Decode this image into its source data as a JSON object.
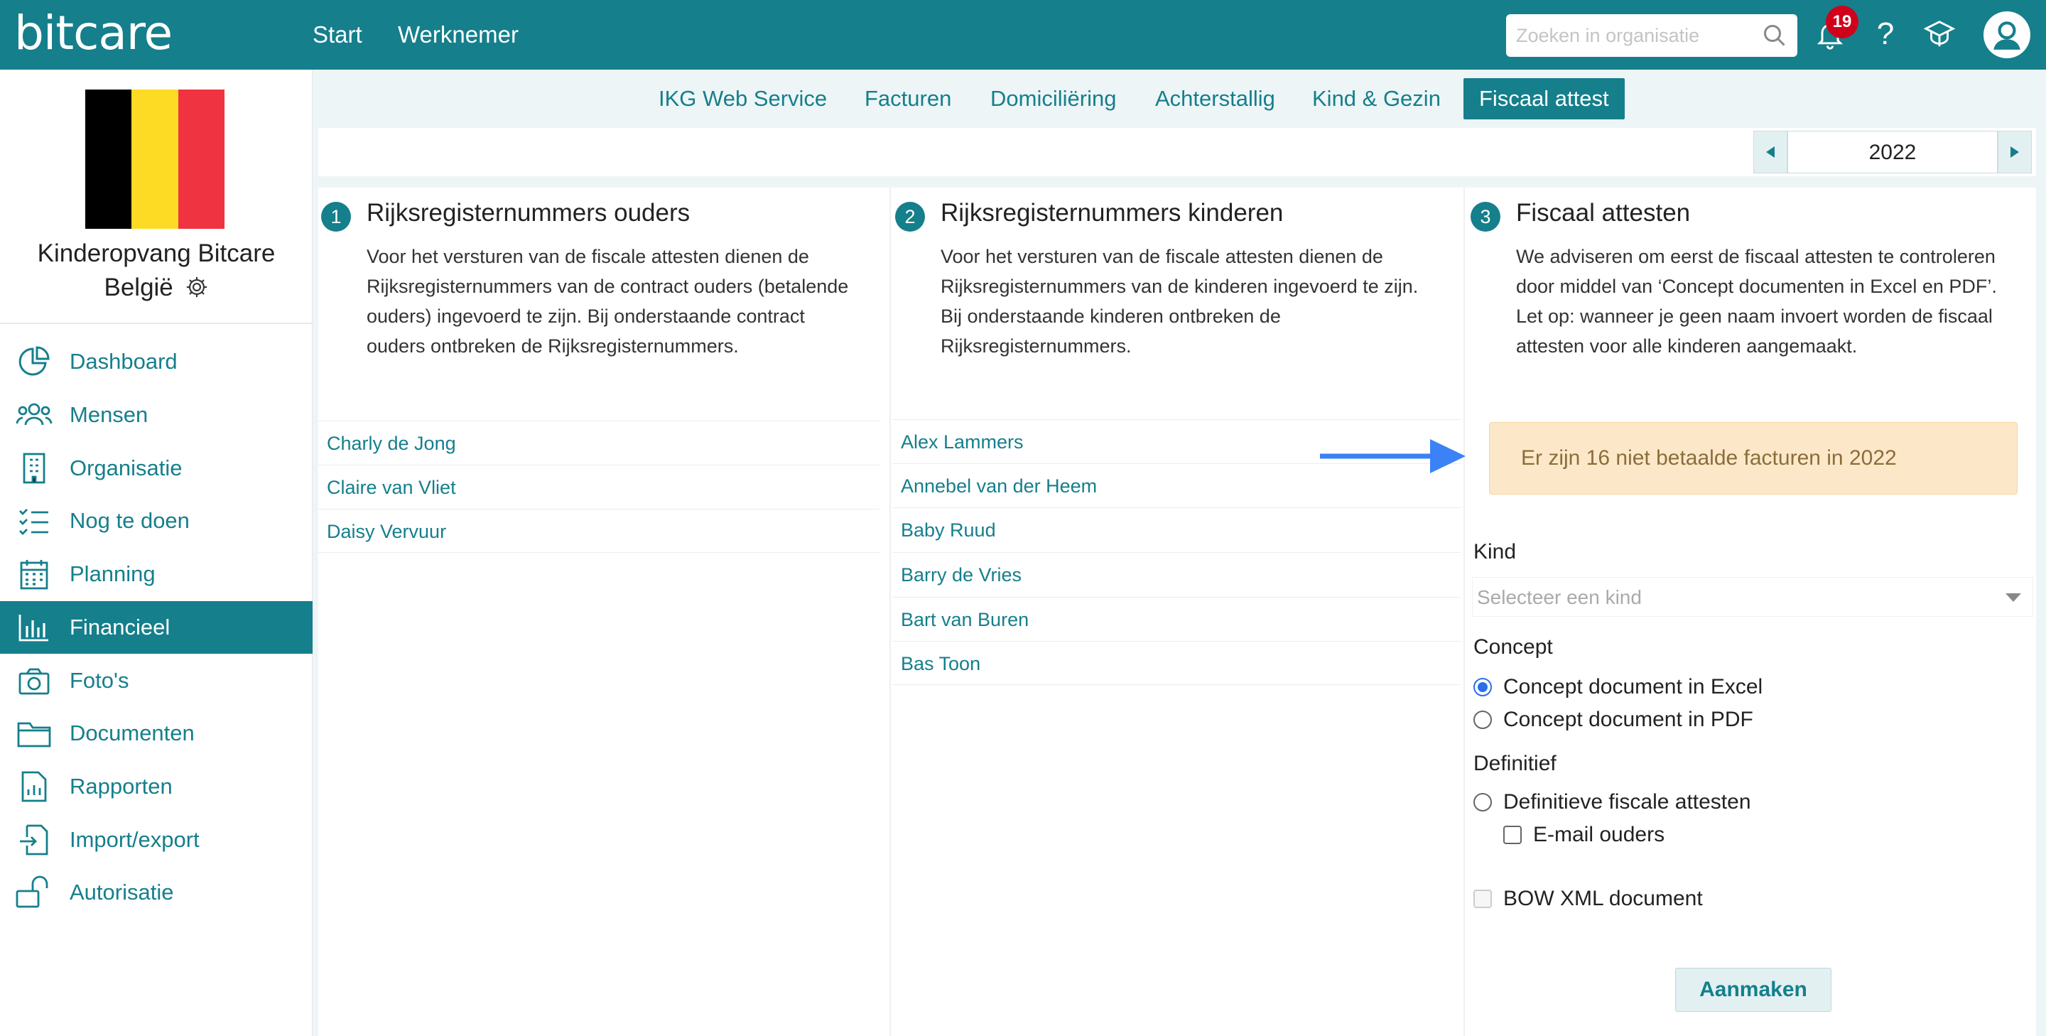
{
  "app": {
    "logo": "bitcare"
  },
  "topnav": {
    "items": [
      "Start",
      "Werknemer"
    ]
  },
  "search": {
    "placeholder": "Zoeken in organisatie"
  },
  "notifications": {
    "count": "19"
  },
  "help": {
    "label": "?"
  },
  "org": {
    "name_line1": "Kinderopvang Bitcare",
    "name_line2": "België"
  },
  "flag_colors": [
    "#000000",
    "#fdda24",
    "#ef3340"
  ],
  "sidebar": {
    "items": [
      {
        "label": "Dashboard",
        "icon": "pie-chart-icon"
      },
      {
        "label": "Mensen",
        "icon": "people-icon"
      },
      {
        "label": "Organisatie",
        "icon": "building-icon"
      },
      {
        "label": "Nog te doen",
        "icon": "checklist-icon"
      },
      {
        "label": "Planning",
        "icon": "calendar-icon"
      },
      {
        "label": "Financieel",
        "icon": "bar-chart-icon",
        "active": true
      },
      {
        "label": "Foto's",
        "icon": "camera-icon"
      },
      {
        "label": "Documenten",
        "icon": "folder-icon"
      },
      {
        "label": "Rapporten",
        "icon": "report-icon"
      },
      {
        "label": "Import/export",
        "icon": "import-export-icon"
      },
      {
        "label": "Autorisatie",
        "icon": "unlock-icon"
      }
    ]
  },
  "tabs": [
    {
      "label": "IKG Web Service"
    },
    {
      "label": "Facturen"
    },
    {
      "label": "Domiciliëring"
    },
    {
      "label": "Achterstallig"
    },
    {
      "label": "Kind & Gezin"
    },
    {
      "label": "Fiscaal attest",
      "active": true
    }
  ],
  "year": {
    "value": "2022"
  },
  "columns": [
    {
      "step": "1",
      "title": "Rijksregisternummers ouders",
      "text": [
        "Voor het versturen van de fiscale attesten dienen de",
        "Rijksregisternummers van de contract ouders (betalende",
        "ouders) ingevoerd te zijn. Bij onderstaande contract",
        "ouders ontbreken de Rijksregisternummers."
      ],
      "list": [
        "Charly de Jong",
        "Claire van Vliet",
        "Daisy Vervuur"
      ]
    },
    {
      "step": "2",
      "title": "Rijksregisternummers kinderen",
      "text": [
        "Voor het versturen van de fiscale attesten dienen de",
        "Rijksregisternummers van de kinderen ingevoerd te zijn.",
        "Bij onderstaande kinderen ontbreken de",
        "Rijksregisternummers."
      ],
      "list": [
        "Alex Lammers",
        "Annebel van der Heem",
        "Baby Ruud",
        "Barry de Vries",
        "Bart van Buren",
        "Bas Toon"
      ]
    },
    {
      "step": "3",
      "title": "Fiscaal attesten",
      "text": [
        "We adviseren om eerst de fiscaal attesten te controleren",
        "door middel van ‘Concept documenten in Excel en PDF’.",
        "Let op: wanneer je geen naam invoert worden de fiscaal",
        "attesten voor alle kinderen aangemaakt."
      ]
    }
  ],
  "alert": {
    "text": "Er zijn 16 niet betaalde facturen in 2022"
  },
  "form": {
    "kind_label": "Kind",
    "kind_placeholder": "Selecteer een kind",
    "concept_label": "Concept",
    "concept_excel": "Concept document in Excel",
    "concept_pdf": "Concept document in PDF",
    "definitief_label": "Definitief",
    "definitief_option": "Definitieve fiscale attesten",
    "email_ouders": "E-mail ouders",
    "bow_xml": "BOW XML document",
    "submit": "Aanmaken"
  },
  "colors": {
    "primary": "#157f8c",
    "alert_bg": "#fce8c8",
    "arrow": "#3b82f6"
  }
}
